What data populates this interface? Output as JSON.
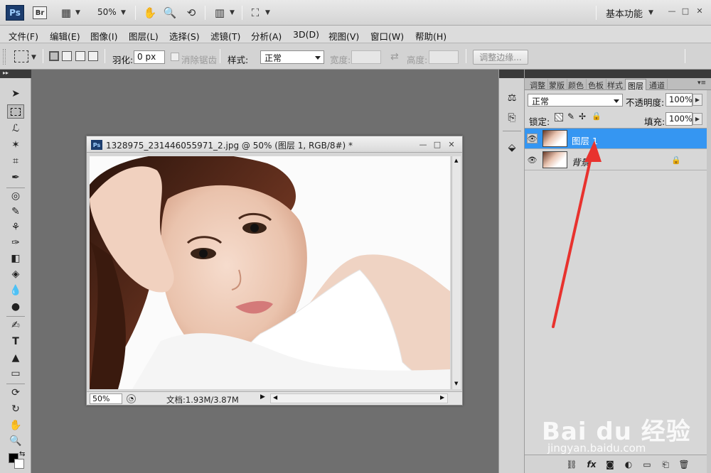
{
  "appbar": {
    "ps_logo": "Ps",
    "br_logo": "Br",
    "zoom": "50%",
    "workspace": "基本功能",
    "icons": [
      "screen-mode-icon",
      "hand-icon",
      "zoom-icon",
      "rotate-view-icon",
      "arrange-documents-icon",
      "screen-mode-frame-icon"
    ]
  },
  "menubar": {
    "items": [
      "文件(F)",
      "编辑(E)",
      "图像(I)",
      "图层(L)",
      "选择(S)",
      "滤镜(T)",
      "分析(A)",
      "3D(D)",
      "视图(V)",
      "窗口(W)",
      "帮助(H)"
    ]
  },
  "optbar": {
    "feather_label": "羽化:",
    "feather_value": "0 px",
    "antialias_label": "消除锯齿",
    "style_label": "样式:",
    "style_value": "正常",
    "width_label": "宽度:",
    "height_label": "高度:",
    "refine_edge": "调整边缘..."
  },
  "document": {
    "title": "1328975_231446055971_2.jpg @ 50% (图层 1, RGB/8#) *",
    "zoom": "50%",
    "doc_info": "文档:1.93M/3.87M"
  },
  "layers_panel": {
    "tabs": [
      "调整",
      "蒙版",
      "颜色",
      "色板",
      "样式",
      "图层",
      "通道"
    ],
    "active_tab": "图层",
    "blend_mode": "正常",
    "opacity_label": "不透明度:",
    "opacity_value": "100%",
    "lock_label": "锁定:",
    "fill_label": "填充:",
    "fill_value": "100%",
    "layers": [
      {
        "name": "图层 1",
        "selected": true
      },
      {
        "name": "背景",
        "selected": false
      }
    ]
  },
  "watermark": {
    "brand": "Bai du 经验",
    "url": "jingyan.baidu.com"
  },
  "colors": {
    "selection_blue": "#3596f2",
    "arrow_red": "#e8322e",
    "workspace_gray": "#6f6f6f"
  }
}
